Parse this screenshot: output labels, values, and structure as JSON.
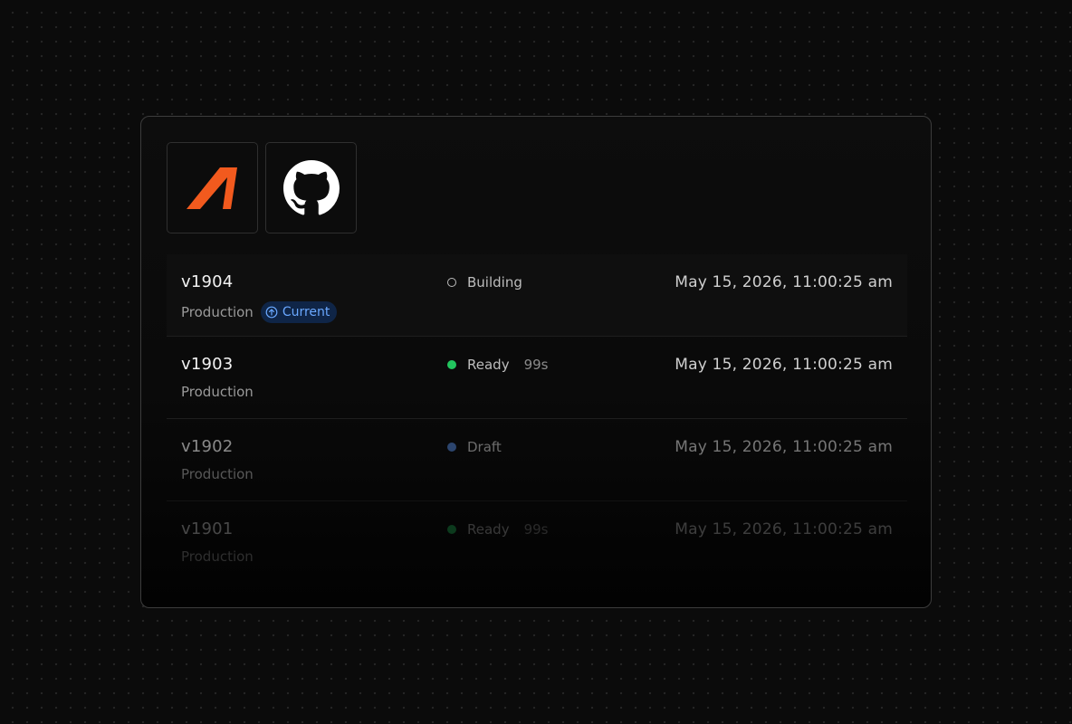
{
  "logos": {
    "brand": {
      "icon": "brand-slash-logo-icon",
      "color": "#f25a1e"
    },
    "github": {
      "icon": "github-icon",
      "color": "#ffffff"
    }
  },
  "deployments": [
    {
      "version": "v1904",
      "environment": "Production",
      "badge": "Current",
      "status": "Building",
      "status_icon": "spinner-ring-icon",
      "status_color": "#bdbdbd",
      "duration": "",
      "timestamp": "May 15, 2026, 11:00:25 am"
    },
    {
      "version": "v1903",
      "environment": "Production",
      "badge": "",
      "status": "Ready",
      "status_icon": "status-dot-icon",
      "status_color": "#22c55e",
      "duration": "99s",
      "timestamp": "May 15, 2026, 11:00:25 am"
    },
    {
      "version": "v1902",
      "environment": "Production",
      "badge": "",
      "status": "Draft",
      "status_icon": "status-dot-icon",
      "status_color": "#4a78c2",
      "duration": "",
      "timestamp": "May 15, 2026, 11:00:25 am"
    },
    {
      "version": "v1901",
      "environment": "Production",
      "badge": "",
      "status": "Ready",
      "status_icon": "status-dot-icon",
      "status_color": "#22c55e",
      "duration": "99s",
      "timestamp": "May 15, 2026, 11:00:25 am"
    }
  ]
}
